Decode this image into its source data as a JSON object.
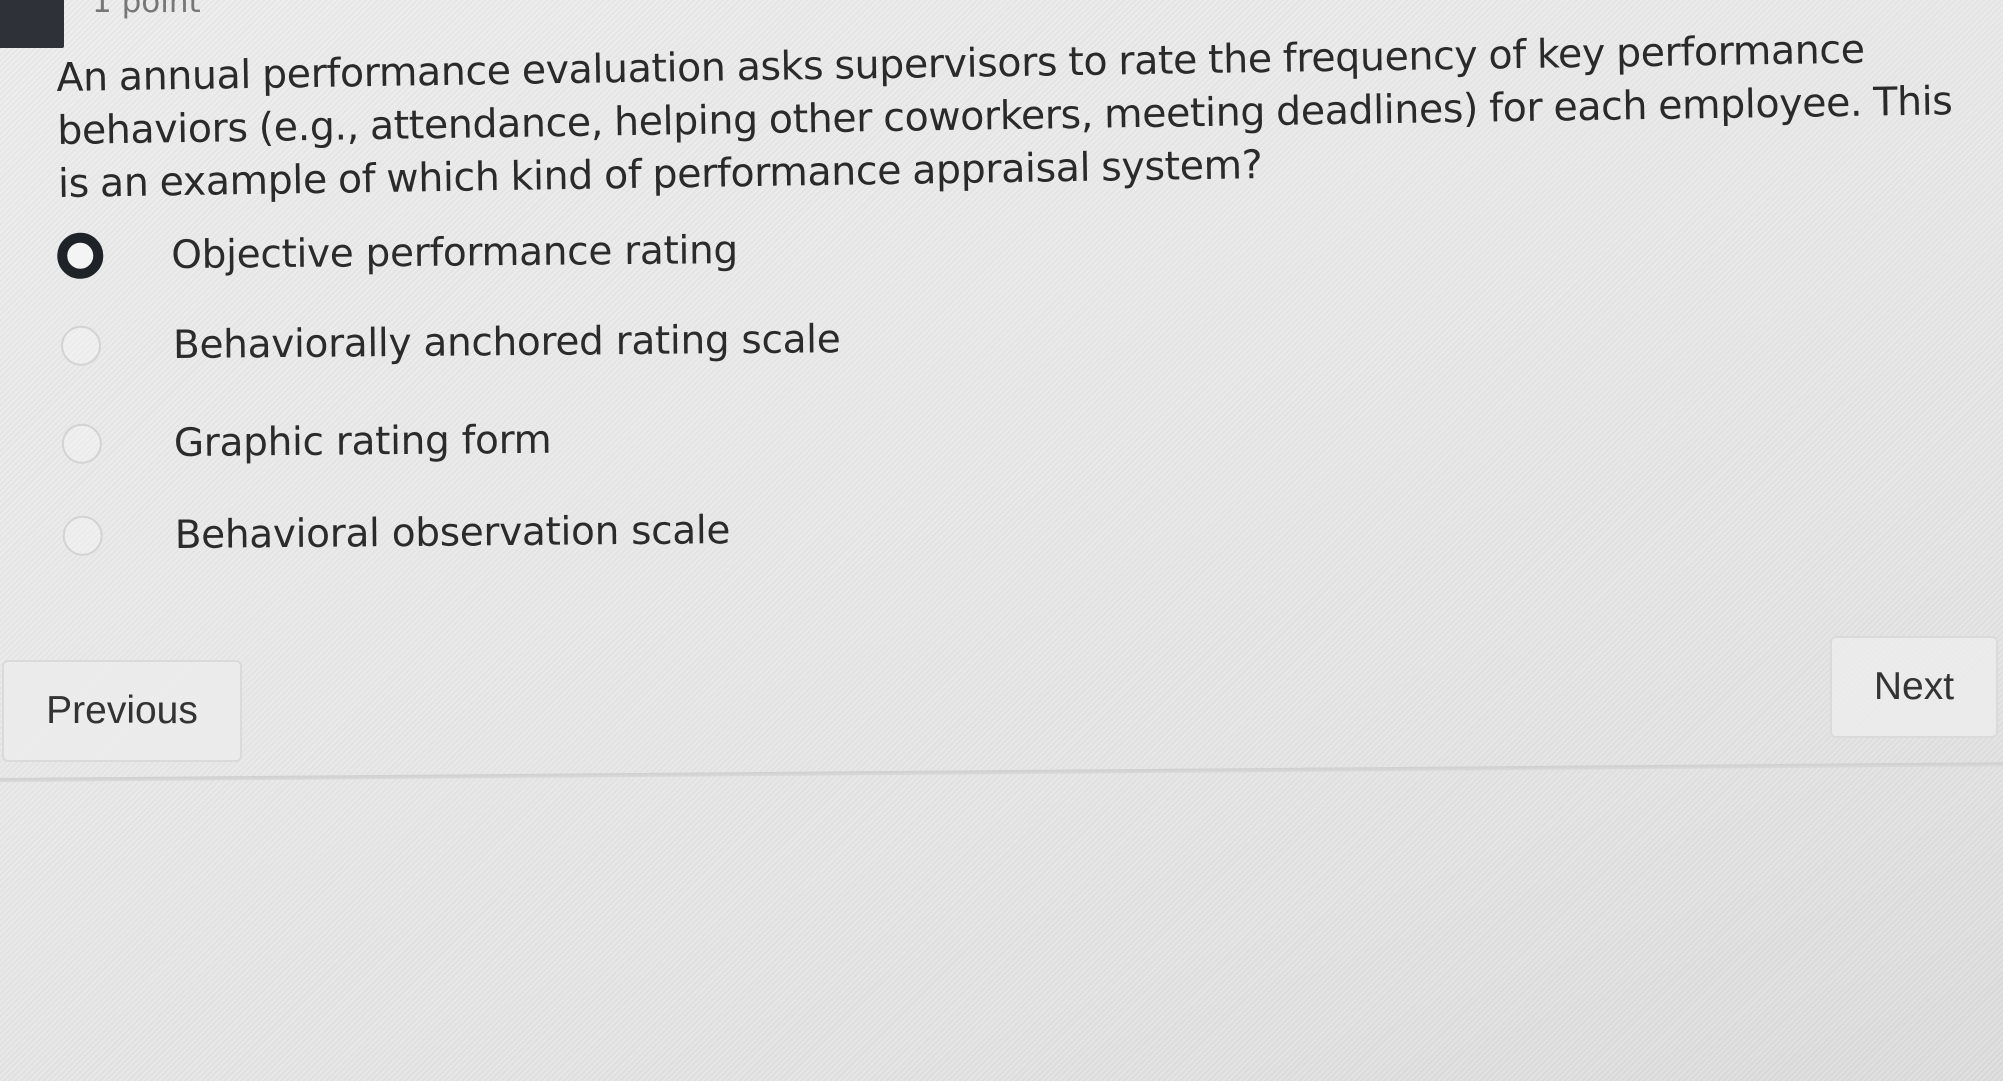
{
  "question": {
    "points": "1 point",
    "text": "An annual performance evaluation asks supervisors to rate the frequency of key performance behaviors (e.g., attendance, helping other coworkers, meeting deadlines) for each employee. This is an example of which kind of performance appraisal system?",
    "options": [
      {
        "label": "Objective performance rating",
        "selected": true
      },
      {
        "label": "Behaviorally anchored rating scale",
        "selected": false
      },
      {
        "label": "Graphic rating form",
        "selected": false
      },
      {
        "label": "Behavioral observation scale",
        "selected": false
      }
    ]
  },
  "navigation": {
    "previous_label": "Previous",
    "next_label": "Next"
  },
  "colors": {
    "selected_radio": "#1f2328",
    "unselected_radio_border": "#d3d3d3",
    "question_tab": "#2e3238"
  }
}
